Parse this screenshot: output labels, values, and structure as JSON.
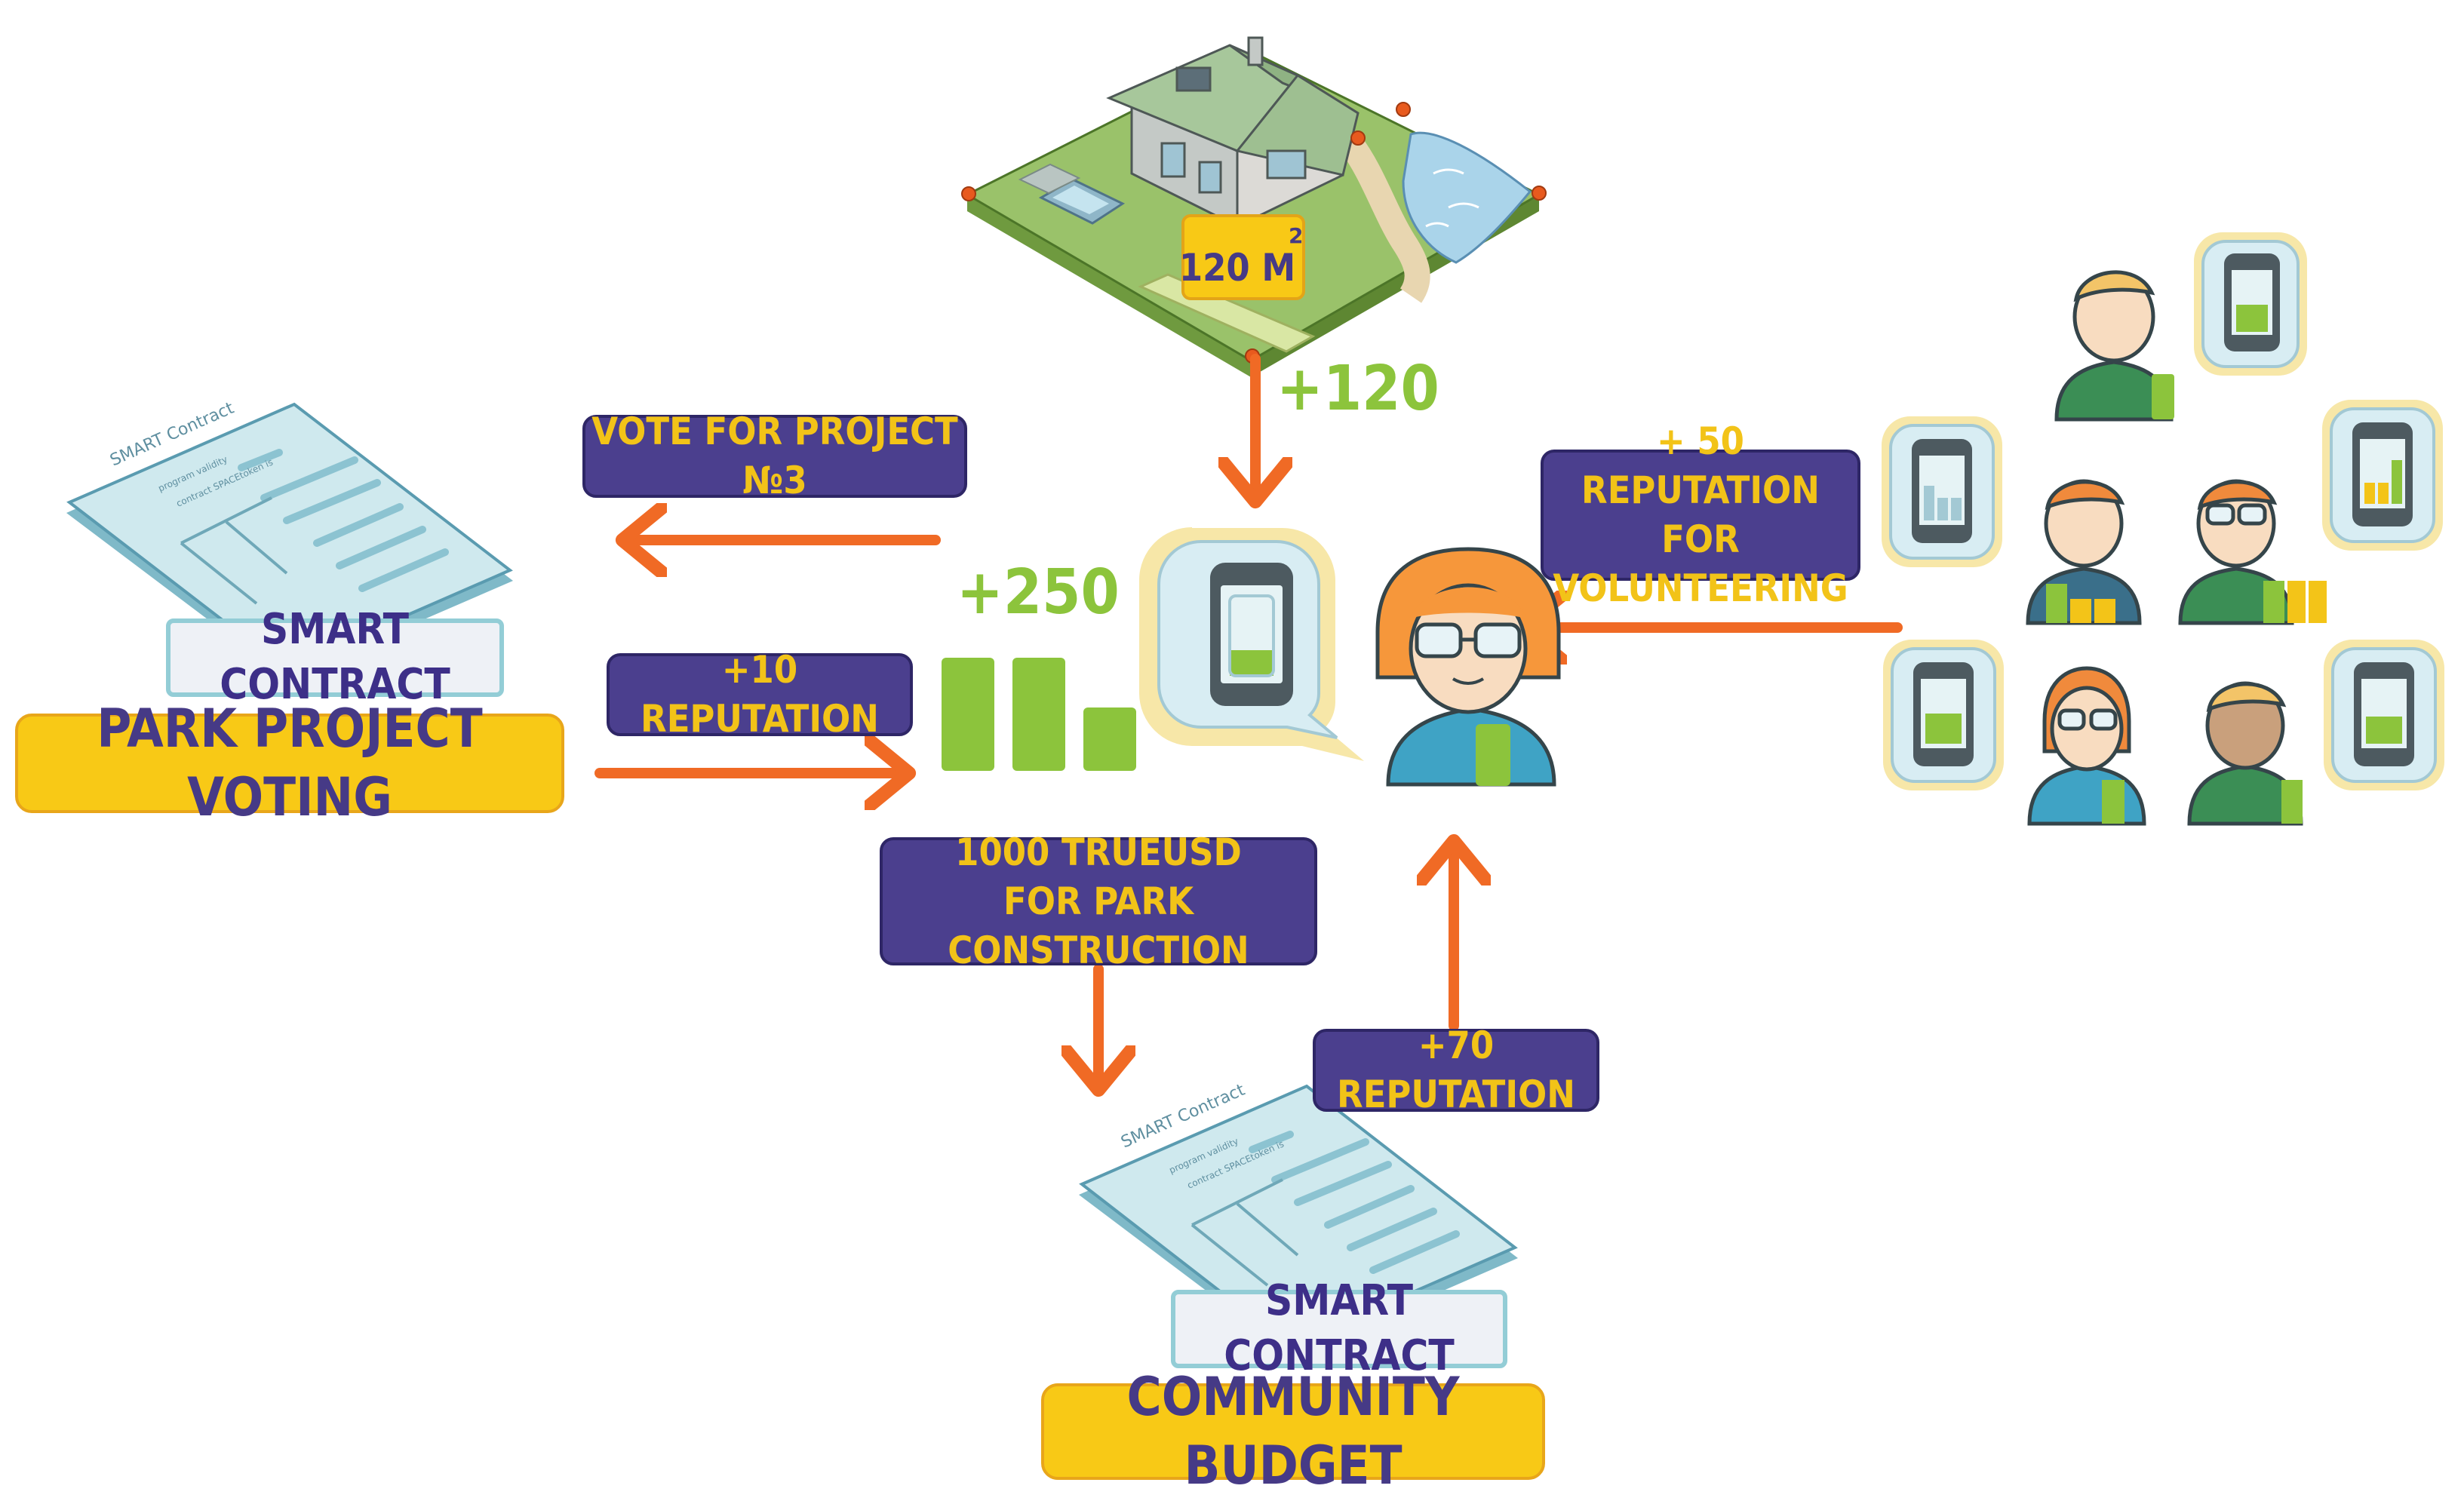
{
  "colors": {
    "arrow": "#f06a25",
    "label_bg": "#4b3f8e",
    "label_text": "#f2c318",
    "title_bg": "#f8c916",
    "title_text": "#463a86",
    "green": "#8cc43c"
  },
  "property": {
    "area_label": "120 M",
    "area_sup": "2",
    "points": "+120"
  },
  "labels": {
    "vote": "VOTE FOR PROJECT  №3",
    "rep10": "+10 REPUTATION",
    "score": "+250",
    "volunteer": "+ 50 REPUTATION\nFOR VOLUNTEERING",
    "trueusd": "1000 TRUEUSD\nFOR PARK CONSTRUCTION",
    "rep70": "+70 REPUTATION"
  },
  "contracts": {
    "left": {
      "tag": "SMART CONTRACT",
      "title": "PARK PROJECT VOTING"
    },
    "bottom": {
      "tag": "SMART CONTRACT",
      "title": "COMMUNITY BUDGET"
    }
  },
  "document": {
    "heading": "SMART Contract",
    "line1": "program validity",
    "line2": "contract SPACEtoken is"
  }
}
